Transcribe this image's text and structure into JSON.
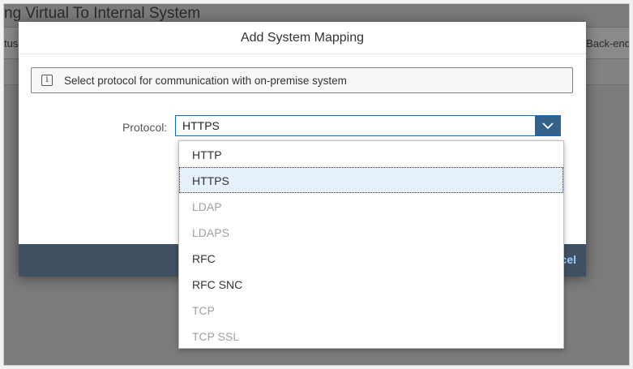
{
  "background": {
    "page_title": "ng Virtual To Internal System",
    "toolbar_left": "tus",
    "toolbar_right": "Back-end"
  },
  "dialog": {
    "title": "Add System Mapping",
    "info": "Select protocol for communication with on-premise system",
    "protocol_label": "Protocol:",
    "protocol_value": "HTTPS",
    "cancel_label": "Cancel"
  },
  "dropdown": {
    "options": [
      {
        "label": "HTTP",
        "state": "enabled"
      },
      {
        "label": "HTTPS",
        "state": "selected"
      },
      {
        "label": "LDAP",
        "state": "disabled"
      },
      {
        "label": "LDAPS",
        "state": "disabled"
      },
      {
        "label": "RFC",
        "state": "enabled"
      },
      {
        "label": "RFC SNC",
        "state": "enabled"
      },
      {
        "label": "TCP",
        "state": "disabled"
      },
      {
        "label": "TCP SSL",
        "state": "disabled"
      }
    ]
  },
  "colors": {
    "accent": "#0a6ed1",
    "arrow_bg": "#346187",
    "footer_bg": "#3f5062",
    "selected_bg": "#e5f0fa",
    "disabled_text": "#a0a0a0"
  }
}
